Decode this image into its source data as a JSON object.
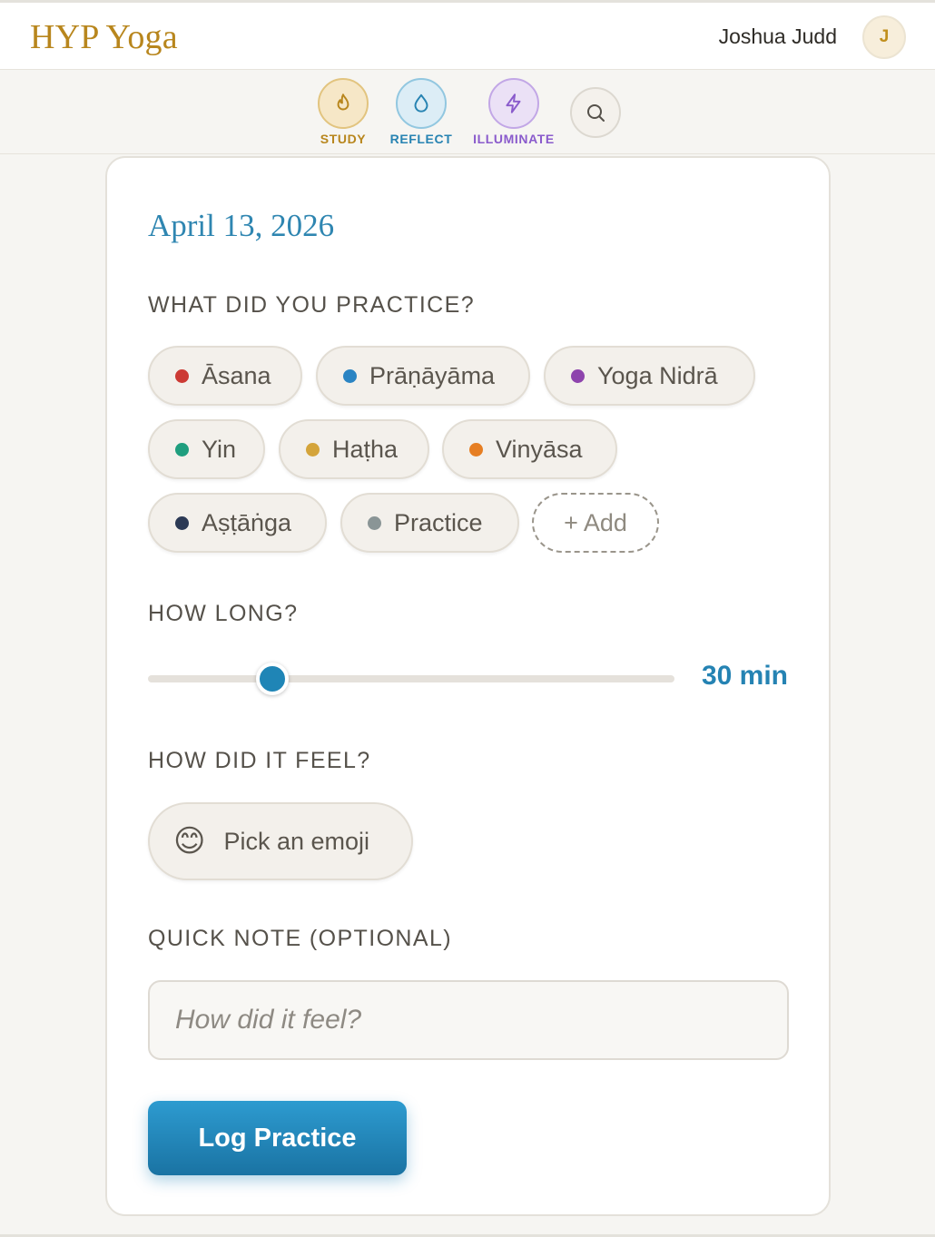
{
  "app": {
    "brand": "HYP Yoga"
  },
  "user": {
    "name": "Joshua Judd",
    "initial": "J"
  },
  "nav": {
    "items": [
      {
        "label": "STUDY",
        "icon": "flame-icon",
        "color": "#b8861d"
      },
      {
        "label": "REFLECT",
        "icon": "droplet-icon",
        "color": "#2783b2"
      },
      {
        "label": "ILLUMINATE",
        "icon": "lightning-icon",
        "color": "#8a5bcc"
      }
    ],
    "search_icon": "search-icon"
  },
  "entry": {
    "date": "April 13, 2026",
    "practice_label": "WHAT DID YOU PRACTICE?",
    "practices": [
      {
        "label": "Āsana",
        "color": "#cc3a34"
      },
      {
        "label": "Prāṇāyāma",
        "color": "#2a84c3"
      },
      {
        "label": "Yoga Nidrā",
        "color": "#8e44ad"
      },
      {
        "label": "Yin",
        "color": "#1f9e7e"
      },
      {
        "label": "Haṭha",
        "color": "#d4a43a"
      },
      {
        "label": "Vinyāsa",
        "color": "#e67e22"
      },
      {
        "label": "Aṣṭāṅga",
        "color": "#2c3a55"
      },
      {
        "label": "Practice",
        "color": "#8a9596"
      }
    ],
    "add_label": "+ Add",
    "duration_label": "HOW LONG?",
    "duration_value": "30 min",
    "duration_fraction": 0.23,
    "feel_label": "HOW DID IT FEEL?",
    "emoji_face": "😊",
    "emoji_button": "Pick an emoji",
    "note_label": "QUICK NOTE (OPTIONAL)",
    "note_placeholder": "How did it feel?",
    "note_value": "",
    "submit_label": "Log Practice"
  }
}
